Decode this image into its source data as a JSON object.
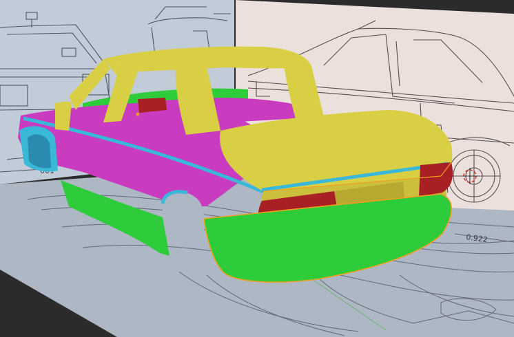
{
  "viewport": {
    "background": "#2b2b2b",
    "theme_colors": {
      "ground_plane": "#aeb7c4",
      "blueprint_front": "#c2ccd8",
      "blueprint_side": "#ece0dc",
      "car_yellow": "#d9cf45",
      "car_magenta": "#c93cc0",
      "car_green": "#2ecc3a",
      "car_cyan": "#39b8d8",
      "car_red": "#a81f24",
      "selection_outline": "#f0a020"
    }
  },
  "blueprint": {
    "ground_dimension_label": "0.922",
    "front_dimension_label": "001"
  },
  "transform_gizmo": {
    "name": "3d-cursor"
  }
}
